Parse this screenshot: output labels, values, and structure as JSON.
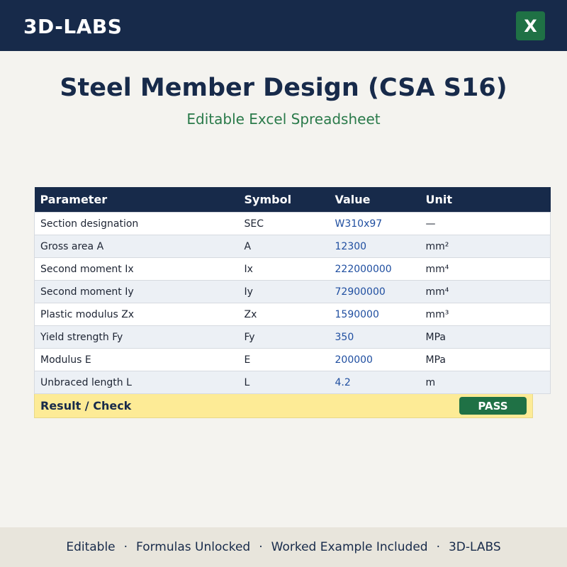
{
  "header": {
    "brand": "3D-LABS",
    "excel_icon_letter": "X"
  },
  "title": "Steel Member Design (CSA S16)",
  "subtitle": "Editable Excel Spreadsheet",
  "table": {
    "columns": [
      "Parameter",
      "Symbol",
      "Value",
      "Unit"
    ],
    "rows": [
      {
        "parameter": "Section designation",
        "symbol": "SEC",
        "value": "W310x97",
        "unit": "—"
      },
      {
        "parameter": "Gross area A",
        "symbol": "A",
        "value": "12300",
        "unit": "mm²"
      },
      {
        "parameter": "Second moment Ix",
        "symbol": "Ix",
        "value": "222000000",
        "unit": "mm⁴"
      },
      {
        "parameter": "Second moment Iy",
        "symbol": "Iy",
        "value": "72900000",
        "unit": "mm⁴"
      },
      {
        "parameter": "Plastic modulus Zx",
        "symbol": "Zx",
        "value": "1590000",
        "unit": "mm³"
      },
      {
        "parameter": "Yield strength Fy",
        "symbol": "Fy",
        "value": "350",
        "unit": "MPa"
      },
      {
        "parameter": "Modulus E",
        "symbol": "E",
        "value": "200000",
        "unit": "MPa"
      },
      {
        "parameter": "Unbraced length L",
        "symbol": "L",
        "value": "4.2",
        "unit": "m"
      }
    ],
    "result_label": "Result / Check",
    "result_status": "PASS"
  },
  "footer": {
    "items": [
      "Editable",
      "Formulas Unlocked",
      "Worked Example Included",
      "3D-LABS"
    ],
    "separator": "·"
  },
  "colors": {
    "navy": "#172a4a",
    "green": "#1f7145",
    "value_blue": "#1f4ea0",
    "result_yellow": "#fdeb96"
  }
}
